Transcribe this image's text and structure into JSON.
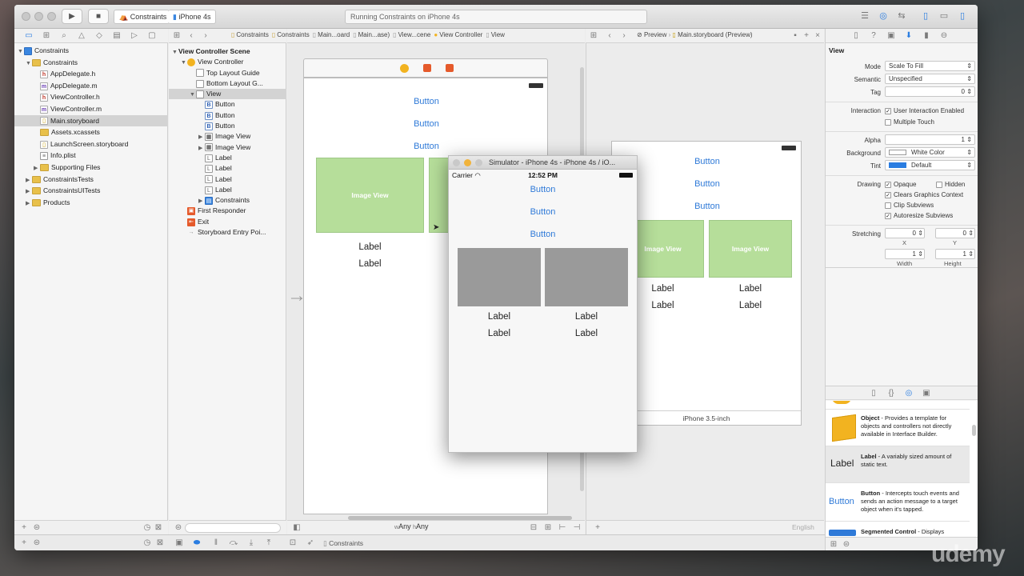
{
  "toolbar": {
    "scheme": "Constraints",
    "device": "iPhone 4s",
    "status": "Running Constraints on iPhone 4s"
  },
  "navigator": {
    "items": [
      {
        "label": "Constraints",
        "icon": "project-icon",
        "indent": 0,
        "open": true
      },
      {
        "label": "Constraints",
        "icon": "folder-icon",
        "indent": 1,
        "open": true
      },
      {
        "label": "AppDelegate.h",
        "icon": "h-file-icon",
        "indent": 2
      },
      {
        "label": "AppDelegate.m",
        "icon": "m-file-icon",
        "indent": 2
      },
      {
        "label": "ViewController.h",
        "icon": "h-file-icon",
        "indent": 2
      },
      {
        "label": "ViewController.m",
        "icon": "m-file-icon",
        "indent": 2
      },
      {
        "label": "Main.storyboard",
        "icon": "storyboard-icon",
        "indent": 2,
        "selected": true
      },
      {
        "label": "Assets.xcassets",
        "icon": "folder-icon",
        "indent": 2
      },
      {
        "label": "LaunchScreen.storyboard",
        "icon": "storyboard-icon",
        "indent": 2
      },
      {
        "label": "Info.plist",
        "icon": "plist-icon",
        "indent": 2
      },
      {
        "label": "Supporting Files",
        "icon": "folder-icon",
        "indent": 2,
        "closed": true
      },
      {
        "label": "ConstraintsTests",
        "icon": "folder-icon",
        "indent": 1,
        "closed": true
      },
      {
        "label": "ConstraintsUITests",
        "icon": "folder-icon",
        "indent": 1,
        "closed": true
      },
      {
        "label": "Products",
        "icon": "folder-icon",
        "indent": 1,
        "closed": true
      }
    ]
  },
  "jumpbar": {
    "items": [
      "Constraints",
      "Constraints",
      "Main...oard",
      "Main...ase)",
      "View...cene",
      "View Controller",
      "View"
    ]
  },
  "outline": {
    "items": [
      {
        "label": "View Controller Scene",
        "indent": 0,
        "bold": true,
        "open": true
      },
      {
        "label": "View Controller",
        "indent": 1,
        "icon": "vc",
        "open": true
      },
      {
        "label": "Top Layout Guide",
        "indent": 2,
        "icon": "guide"
      },
      {
        "label": "Bottom Layout G...",
        "indent": 2,
        "icon": "guide"
      },
      {
        "label": "View",
        "indent": 2,
        "icon": "guide",
        "open": true,
        "selected": true
      },
      {
        "label": "Button",
        "indent": 3,
        "icon": "B"
      },
      {
        "label": "Button",
        "indent": 3,
        "icon": "B"
      },
      {
        "label": "Button",
        "indent": 3,
        "icon": "B"
      },
      {
        "label": "Image View",
        "indent": 3,
        "icon": "img",
        "closed": true
      },
      {
        "label": "Image View",
        "indent": 3,
        "icon": "img",
        "closed": true
      },
      {
        "label": "Label",
        "indent": 3,
        "icon": "L"
      },
      {
        "label": "Label",
        "indent": 3,
        "icon": "L"
      },
      {
        "label": "Label",
        "indent": 3,
        "icon": "L"
      },
      {
        "label": "Label",
        "indent": 3,
        "icon": "L"
      },
      {
        "label": "Constraints",
        "indent": 3,
        "icon": "con",
        "closed": true
      },
      {
        "label": "First Responder",
        "indent": 1,
        "icon": "fr"
      },
      {
        "label": "Exit",
        "indent": 1,
        "icon": "exit"
      },
      {
        "label": "Storyboard Entry Poi...",
        "indent": 1,
        "icon": "arrow"
      }
    ]
  },
  "canvas": {
    "buttons": [
      "Button",
      "Button",
      "Button"
    ],
    "image_view": "Image View",
    "labels": [
      "Label",
      "Label"
    ],
    "size_class": {
      "w": "w",
      "any1": "Any",
      "h": "h",
      "any2": "Any"
    }
  },
  "simulator": {
    "title": "Simulator - iPhone 4s - iPhone 4s / iO...",
    "carrier": "Carrier",
    "time": "12:52 PM",
    "buttons": [
      "Button",
      "Button",
      "Button"
    ],
    "labels": [
      "Label",
      "Label",
      "Label",
      "Label"
    ]
  },
  "preview": {
    "jump": [
      "Preview",
      "Main.storyboard (Preview)"
    ],
    "buttons": [
      "Button",
      "Button",
      "Button"
    ],
    "image_view": "Image View",
    "labels": [
      "Label",
      "Label",
      "Label",
      "Label"
    ],
    "device": "iPhone 3.5-inch",
    "language": "English"
  },
  "inspector": {
    "section": "View",
    "mode_label": "Mode",
    "mode": "Scale To Fill",
    "semantic_label": "Semantic",
    "semantic": "Unspecified",
    "tag_label": "Tag",
    "tag": "0",
    "interaction_label": "Interaction",
    "user_interaction": "User Interaction Enabled",
    "multiple_touch": "Multiple Touch",
    "alpha_label": "Alpha",
    "alpha": "1",
    "background_label": "Background",
    "background": "White Color",
    "tint_label": "Tint",
    "tint": "Default",
    "drawing_label": "Drawing",
    "opaque": "Opaque",
    "hidden": "Hidden",
    "clears": "Clears Graphics Context",
    "clip": "Clip Subviews",
    "autoresize": "Autoresize Subviews",
    "stretching_label": "Stretching",
    "x": "0",
    "y": "0",
    "width": "1",
    "height": "1",
    "x_label": "X",
    "y_label": "Y",
    "width_label": "Width",
    "height_label": "Height"
  },
  "library": {
    "items": [
      {
        "title": "Object",
        "desc": " - Provides a template for objects and controllers not directly available in Interface Builder."
      },
      {
        "title": "Label",
        "desc": " - A variably sized amount of static text.",
        "big": "Label"
      },
      {
        "title": "Button",
        "desc": " - Intercepts touch events and sends an action message to a target object when it's tapped.",
        "big": "Button"
      },
      {
        "title": "Segmented Control",
        "desc": " - Displays"
      }
    ]
  },
  "debugbar": {
    "target": "Constraints"
  },
  "watermark": "udemy"
}
